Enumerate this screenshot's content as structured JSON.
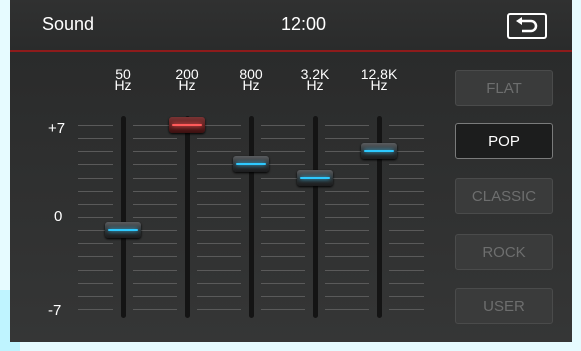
{
  "header": {
    "title": "Sound",
    "clock": "12:00",
    "back_icon": "return-arrow-icon"
  },
  "equalizer": {
    "scale": {
      "top": "+7",
      "middle": "0",
      "bottom": "-7"
    },
    "bands": [
      {
        "freq": "50",
        "unit": "Hz",
        "level": -1,
        "highlight": false
      },
      {
        "freq": "200",
        "unit": "Hz",
        "level": 7,
        "highlight": true
      },
      {
        "freq": "800",
        "unit": "Hz",
        "level": 4,
        "highlight": false
      },
      {
        "freq": "3.2K",
        "unit": "Hz",
        "level": 3,
        "highlight": false
      },
      {
        "freq": "12.8K",
        "unit": "Hz",
        "level": 5,
        "highlight": false
      }
    ]
  },
  "presets": [
    {
      "label": "FLAT",
      "selected": false
    },
    {
      "label": "POP",
      "selected": true
    },
    {
      "label": "CLASSIC",
      "selected": false
    },
    {
      "label": "ROCK",
      "selected": false
    },
    {
      "label": "USER",
      "selected": false
    }
  ],
  "colors": {
    "accent_blue": "#2ec9ff",
    "accent_red": "#ff5a5a",
    "header_line": "#8e1b1b"
  }
}
